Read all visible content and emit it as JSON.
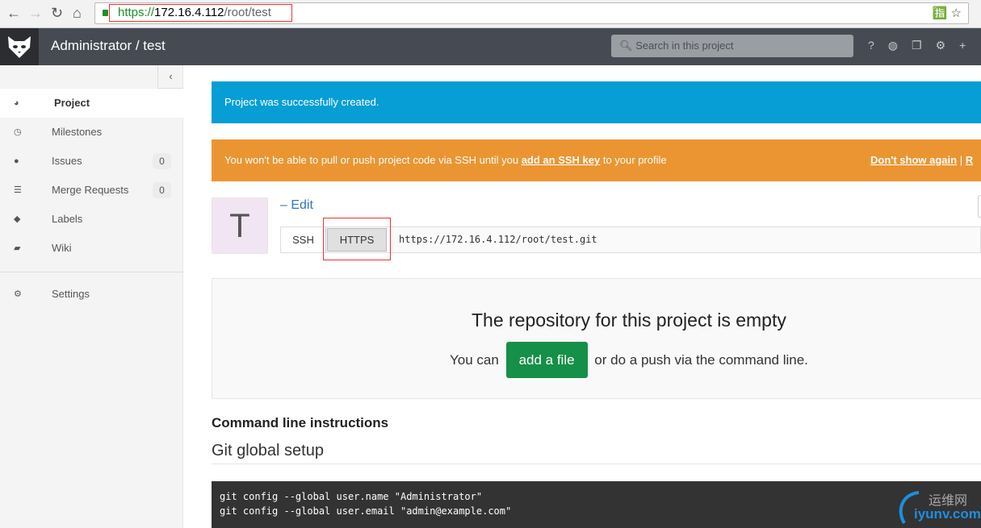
{
  "browser": {
    "url_scheme": "https://",
    "url_host": "172.16.4.112",
    "url_path": "/root/test"
  },
  "navbar": {
    "title": "Administrator / test",
    "search_placeholder": "Search in this project"
  },
  "sidebar": {
    "collapse": "‹",
    "items": [
      {
        "label": "Project",
        "icon": "dashboard-icon"
      },
      {
        "label": "Milestones",
        "icon": "clock-icon"
      },
      {
        "label": "Issues",
        "icon": "exclamation-icon",
        "count": "0"
      },
      {
        "label": "Merge Requests",
        "icon": "merge-icon",
        "count": "0"
      },
      {
        "label": "Labels",
        "icon": "tags-icon"
      },
      {
        "label": "Wiki",
        "icon": "book-icon"
      },
      {
        "label": "Settings",
        "icon": "cogs-icon"
      }
    ]
  },
  "alerts": {
    "success": "Project was successfully created.",
    "ssh_pre": "You won't be able to pull or push project code via SSH until you ",
    "ssh_link": "add an SSH key",
    "ssh_post": " to your profile",
    "dont_show": "Don't show again",
    "sep": " | ",
    "remind": "R"
  },
  "project": {
    "avatar_letter": "T",
    "edit": "– Edit",
    "ssh": "SSH",
    "https": "HTTPS",
    "clone_url": "https://172.16.4.112/root/test.git"
  },
  "empty": {
    "title": "The repository for this project is empty",
    "pre": "You can",
    "add_file": "add a file",
    "post": "or do a push via the command line."
  },
  "instructions": {
    "heading": "Command line instructions",
    "git_global": "Git global setup",
    "code": "git config --global user.name \"Administrator\"\ngit config --global user.email \"admin@example.com\""
  },
  "watermark": {
    "cn": "运维网",
    "en": "iyunv.com"
  }
}
